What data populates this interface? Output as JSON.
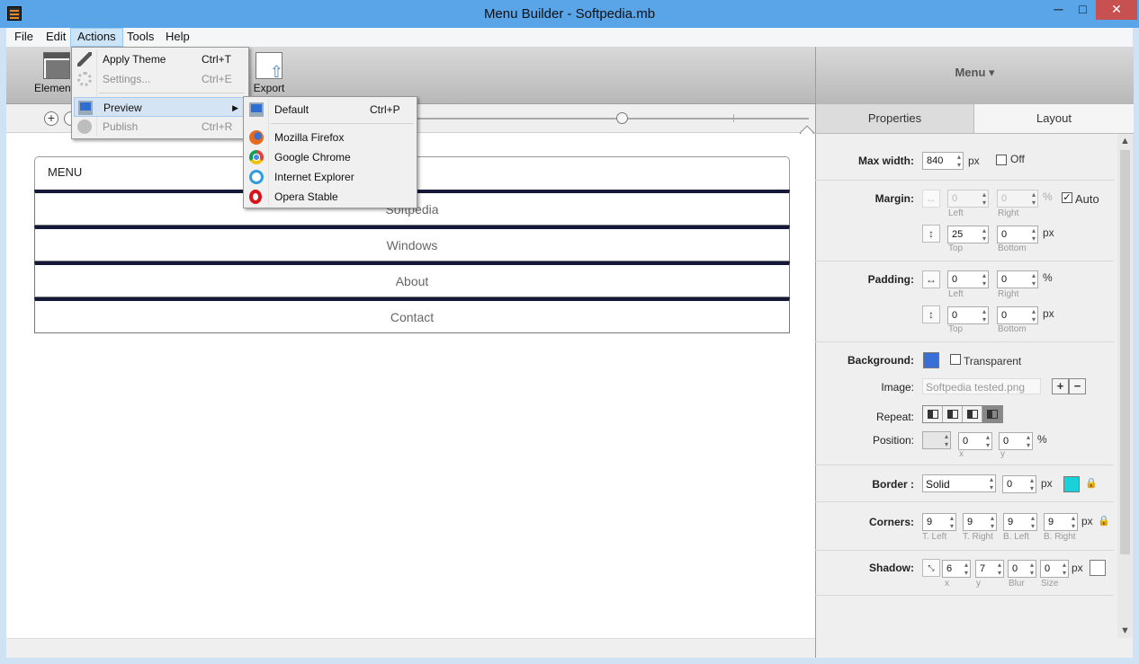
{
  "window": {
    "title": "Menu Builder - Softpedia.mb",
    "minimize": "─",
    "maximize": "□",
    "close": "✕"
  },
  "menubar": {
    "items": [
      {
        "label": "File"
      },
      {
        "label": "Edit"
      },
      {
        "label": "Actions"
      },
      {
        "label": "Tools"
      },
      {
        "label": "Help"
      }
    ]
  },
  "toolbar": {
    "elements_label": "Elements",
    "export_label": "Export"
  },
  "zoom": {
    "plus": "+",
    "level_fraction": 0.54
  },
  "preview_menu": {
    "header": "MENU",
    "items": [
      "Softpedia",
      "Windows",
      "About",
      "Contact"
    ]
  },
  "actions_menu": {
    "items": [
      {
        "label": "Apply Theme",
        "shortcut": "Ctrl+T",
        "icon": "pencil-icon",
        "enabled": true
      },
      {
        "label": "Settings...",
        "shortcut": "Ctrl+E",
        "icon": "gear-icon",
        "enabled": false
      },
      {
        "label": "Preview",
        "shortcut": "",
        "icon": "monitor-icon",
        "enabled": true
      },
      {
        "label": "Publish",
        "shortcut": "Ctrl+R",
        "icon": "globe-icon",
        "enabled": false
      }
    ]
  },
  "preview_submenu": {
    "items": [
      {
        "label": "Default",
        "shortcut": "Ctrl+P",
        "icon": "monitor-icon"
      },
      {
        "label": "Mozilla Firefox",
        "icon": "firefox-icon"
      },
      {
        "label": "Google Chrome",
        "icon": "chrome-icon"
      },
      {
        "label": "Internet Explorer",
        "icon": "ie-icon"
      },
      {
        "label": "Opera Stable",
        "icon": "opera-icon"
      }
    ]
  },
  "right_panel": {
    "header": "Menu ▾",
    "tabs": [
      "Properties",
      "Layout"
    ],
    "max_width": {
      "label": "Max width:",
      "value": "840",
      "unit": "px",
      "off_label": "Off"
    },
    "margin": {
      "label": "Margin:",
      "left": "0",
      "right": "0",
      "unit_lr": "%",
      "auto_label": "Auto",
      "top": "25",
      "bottom": "0",
      "unit_tb": "px",
      "sub_left": "Left",
      "sub_right": "Right",
      "sub_top": "Top",
      "sub_bottom": "Bottom"
    },
    "padding": {
      "label": "Padding:",
      "left": "0",
      "right": "0",
      "unit_lr": "%",
      "top": "0",
      "bottom": "0",
      "unit_tb": "px",
      "sub_left": "Left",
      "sub_right": "Right",
      "sub_top": "Top",
      "sub_bottom": "Bottom"
    },
    "background": {
      "label": "Background:",
      "color": "#3a6fd8",
      "transparent_label": "Transparent",
      "image_label": "Image:",
      "image_value": "Softpedia tested.png",
      "repeat_label": "Repeat:",
      "position_label": "Position:",
      "pos_x": "0",
      "pos_y": "0",
      "pos_unit": "%",
      "sub_x": "x",
      "sub_y": "y"
    },
    "border": {
      "label": "Border :",
      "style": "Solid",
      "width": "0",
      "unit": "px",
      "color": "#19d1d8"
    },
    "corners": {
      "label": "Corners:",
      "tl": "9",
      "tr": "9",
      "bl": "9",
      "br": "9",
      "unit": "px",
      "sub_tl": "T. Left",
      "sub_tr": "T. Right",
      "sub_bl": "B. Left",
      "sub_br": "B. Right"
    },
    "shadow": {
      "label": "Shadow:",
      "x": "6",
      "y": "7",
      "blur": "0",
      "size": "0",
      "unit": "px",
      "sub_x": "x",
      "sub_y": "y",
      "sub_blur": "Blur",
      "sub_size": "Size"
    }
  }
}
